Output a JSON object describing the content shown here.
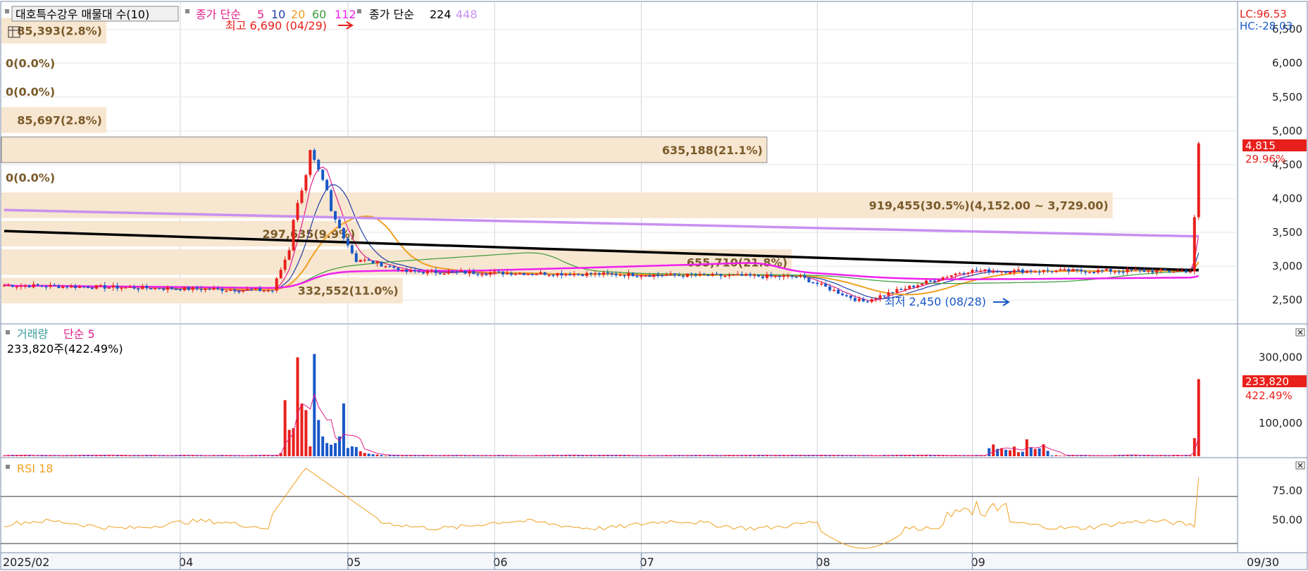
{
  "header": {
    "title_box": "대호특수강우 매물대 수(10)",
    "ma_label": "종가 단순",
    "ma_periods": [
      "5",
      "10",
      "20",
      "60",
      "112"
    ],
    "ma2_label": "종가 단순",
    "ma2_periods": [
      "224",
      "448"
    ],
    "lc_text": "LC:96.53",
    "hc_text": "HC:-28.03"
  },
  "annotations": {
    "high_text": "최고 6,690 (04/29)",
    "low_text": "최저 2,450 (08/28)"
  },
  "price_tag": {
    "value": "4,815",
    "pct": "29.96%"
  },
  "volume_panel": {
    "title": "거래량",
    "ma_label": "단순 5",
    "current_text": "233,820주(422.49%)",
    "tag_value": "233,820",
    "tag_pct": "422.49%"
  },
  "rsi_panel": {
    "title": "RSI 18"
  },
  "colors": {
    "up": "#e8201c",
    "down": "#1a58c8",
    "band_fill": "#f7e6d0",
    "band_text": "#7a5a2a",
    "ma5": "#e0208a",
    "ma10": "#1f3ea8",
    "ma20": "#f0a020",
    "ma60": "#3a9a3a",
    "ma112": "#ee20ee",
    "ma224": "#000000",
    "ma448": "#c890f0",
    "rsi": "#f0a020"
  },
  "chart_data": [
    {
      "type": "candlestick",
      "title": "대호특수강우",
      "y_ticks": [
        2500,
        3000,
        3500,
        4000,
        4500,
        5000,
        5500,
        6000,
        6500
      ],
      "y_tick_labels": [
        "2,500",
        "3,000",
        "3,500",
        "4,000",
        "4,500",
        "5,000",
        "5,500",
        "6,000",
        "6,500"
      ],
      "ylim": [
        2200,
        6850
      ],
      "x_tick_labels": [
        "2025/02",
        "04",
        "05",
        "06",
        "07",
        "08",
        "09",
        "09/30"
      ],
      "x_tick_positions": [
        0,
        42,
        82,
        117,
        152,
        194,
        231,
        281
      ],
      "volume_profile": [
        {
          "price": 6480,
          "label": "85,393(2.8%)",
          "width": 0.085
        },
        {
          "price": 6000,
          "label": "0(0.0%)",
          "width": 0.0
        },
        {
          "price": 5580,
          "label": "0(0.0%)",
          "width": 0.0
        },
        {
          "price": 5160,
          "label": "85,697(2.8%)",
          "width": 0.085
        },
        {
          "price": 4720,
          "label": "635,188(21.1%)",
          "width": 0.62
        },
        {
          "price": 4310,
          "label": "0(0.0%)",
          "width": 0.0
        },
        {
          "price": 3900,
          "label": "919,455(30.5%)(4,152.00 ~ 3,729.00)",
          "width": 0.9
        },
        {
          "price": 3480,
          "label": "297,635(9.9%)",
          "width": 0.29
        },
        {
          "price": 3060,
          "label": "655,710(21.8%)",
          "width": 0.64
        },
        {
          "price": 2640,
          "label": "332,552(11.0%)",
          "width": 0.325
        }
      ],
      "profile_bin_height": 420,
      "series": [
        {
          "name": "종가 단순 5",
          "key": "ma5"
        },
        {
          "name": "10",
          "key": "ma10"
        },
        {
          "name": "20",
          "key": "ma20"
        },
        {
          "name": "60",
          "key": "ma60"
        },
        {
          "name": "112",
          "key": "ma112"
        },
        {
          "name": "224",
          "key": "ma224"
        },
        {
          "name": "448",
          "key": "ma448"
        }
      ],
      "high": {
        "value": 6690,
        "date": "04/29"
      },
      "low": {
        "value": 2450,
        "date": "08/28"
      },
      "last_close": 4815
    },
    {
      "type": "bar",
      "title": "거래량",
      "y_ticks": [
        100000,
        300000
      ],
      "y_tick_labels": [
        "100,000",
        "300,000"
      ],
      "ylim": [
        0,
        380000
      ],
      "last_value": 233820
    },
    {
      "type": "line",
      "title": "RSI 18",
      "y_ticks": [
        50,
        75
      ],
      "y_tick_labels": [
        "50.00",
        "75.00"
      ],
      "ylim": [
        24,
        100
      ],
      "overbought": 70,
      "oversold": 30
    }
  ]
}
